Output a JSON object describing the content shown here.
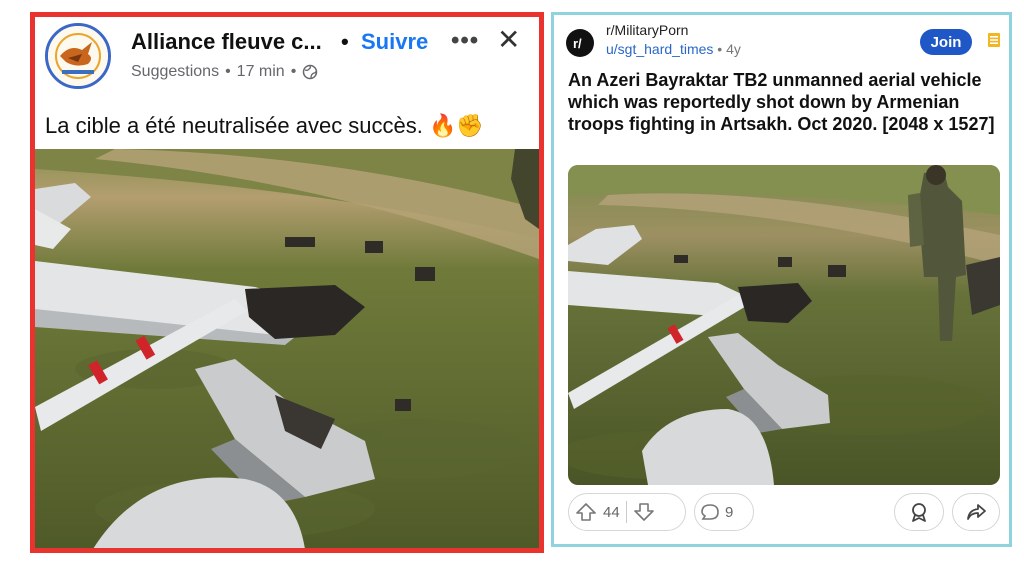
{
  "facebook_post": {
    "page_name": "Alliance fleuve c...",
    "follow_label": "Suivre",
    "separator_dot": "•",
    "more_glyph": "•••",
    "close_glyph": "✕",
    "meta_suggestion": "Suggestions",
    "meta_time": "17 min",
    "meta_dot": "•",
    "caption": "La cible a été neutralisée avec succès. 🔥✊",
    "accent_border_color": "#e8332e",
    "follow_color": "#1877f2"
  },
  "reddit_post": {
    "subreddit": "r/MilitaryPorn",
    "username": "u/sgt_hard_times",
    "age": "• 4y",
    "join_label": "Join",
    "title": "An Azeri Bayraktar TB2 unmanned aerial vehicle which was reportedly shot down by Armenian troops fighting in Artsakh. Oct 2020. [2048 x 1527]",
    "upvotes": "44",
    "comments": "9",
    "border_color": "#8fd3de",
    "join_color": "#1f57c7",
    "icons": [
      "upvote-icon",
      "downvote-icon",
      "comment-icon",
      "award-icon",
      "share-icon"
    ]
  }
}
